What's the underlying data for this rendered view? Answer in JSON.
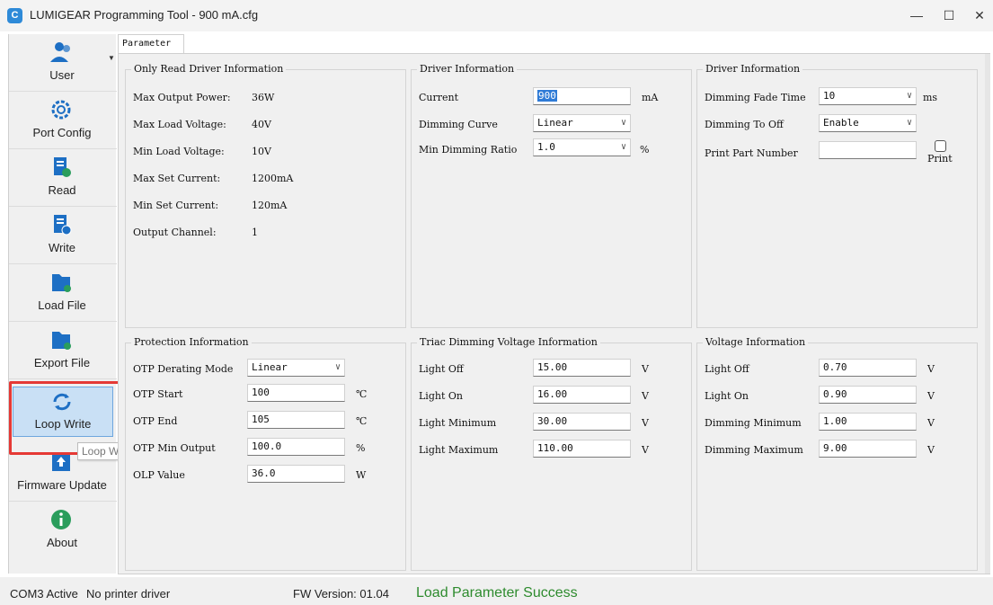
{
  "window": {
    "title": "LUMIGEAR Programming Tool - 900 mA.cfg",
    "min_symbol": "—",
    "max_symbol": "☐",
    "close_symbol": "✕"
  },
  "sidebar": {
    "items": [
      {
        "label": "User",
        "icon": "user-icon"
      },
      {
        "label": "Port Config",
        "icon": "port-config-icon"
      },
      {
        "label": "Read",
        "icon": "read-icon"
      },
      {
        "label": "Write",
        "icon": "write-icon"
      },
      {
        "label": "Load File",
        "icon": "load-file-icon"
      },
      {
        "label": "Export File",
        "icon": "export-file-icon"
      },
      {
        "label": "Loop Write",
        "icon": "loop-write-icon"
      },
      {
        "label": "Firmware Update",
        "icon": "firmware-update-icon"
      },
      {
        "label": "About",
        "icon": "about-icon"
      }
    ],
    "tooltip": "Loop Write"
  },
  "tab": {
    "label": "Parameter"
  },
  "readonly_info": {
    "title": "Only Read Driver Information",
    "rows": [
      {
        "label": "Max Output Power:",
        "value": "36W"
      },
      {
        "label": "Max Load Voltage:",
        "value": "40V"
      },
      {
        "label": "Min Load Voltage:",
        "value": "10V"
      },
      {
        "label": "Max Set Current:",
        "value": "1200mA"
      },
      {
        "label": "Min Set Current:",
        "value": "120mA"
      },
      {
        "label": "Output Channel:",
        "value": "1"
      }
    ]
  },
  "driver_info_1": {
    "title": "Driver Information",
    "current_label": "Current",
    "current_value": "900",
    "current_unit": "mA",
    "dimming_curve_label": "Dimming Curve",
    "dimming_curve_value": "Linear",
    "min_dimming_ratio_label": "Min Dimming Ratio",
    "min_dimming_ratio_value": "1.0",
    "min_dimming_ratio_unit": "%"
  },
  "driver_info_2": {
    "title": "Driver Information",
    "fade_label": "Dimming Fade Time",
    "fade_value": "10",
    "fade_unit": "ms",
    "to_off_label": "Dimming To Off",
    "to_off_value": "Enable",
    "print_label": "Print Part Number",
    "print_value": "",
    "print_checkbox_label": "Print"
  },
  "protection": {
    "title": "Protection Information",
    "otp_mode_label": "OTP Derating Mode",
    "otp_mode_value": "Linear",
    "rows": [
      {
        "label": "OTP Start",
        "value": "100",
        "unit": "℃"
      },
      {
        "label": "OTP End",
        "value": "105",
        "unit": "℃"
      },
      {
        "label": "OTP Min Output",
        "value": "100.0",
        "unit": "%"
      },
      {
        "label": "OLP Value",
        "value": "36.0",
        "unit": "W"
      }
    ]
  },
  "triac": {
    "title": "Triac Dimming Voltage Information",
    "rows": [
      {
        "label": "Light Off",
        "value": "15.00",
        "unit": "V"
      },
      {
        "label": "Light On",
        "value": "16.00",
        "unit": "V"
      },
      {
        "label": "Light Minimum",
        "value": "30.00",
        "unit": "V"
      },
      {
        "label": "Light Maximum",
        "value": "110.00",
        "unit": "V"
      }
    ]
  },
  "voltage": {
    "title": "Voltage Information",
    "rows": [
      {
        "label": "Light Off",
        "value": "0.70",
        "unit": "V"
      },
      {
        "label": "Light On",
        "value": "0.90",
        "unit": "V"
      },
      {
        "label": "Dimming Minimum",
        "value": "1.00",
        "unit": "V"
      },
      {
        "label": "Dimming Maximum",
        "value": "9.00",
        "unit": "V"
      }
    ]
  },
  "status": {
    "port": "COM3 Active",
    "printer": "No printer driver",
    "fw": "FW Version: 01.04",
    "message": "Load Parameter Success"
  },
  "colors": {
    "accent": "#2f7bd6",
    "success": "#2e8b2e",
    "highlight": "#e53935"
  }
}
